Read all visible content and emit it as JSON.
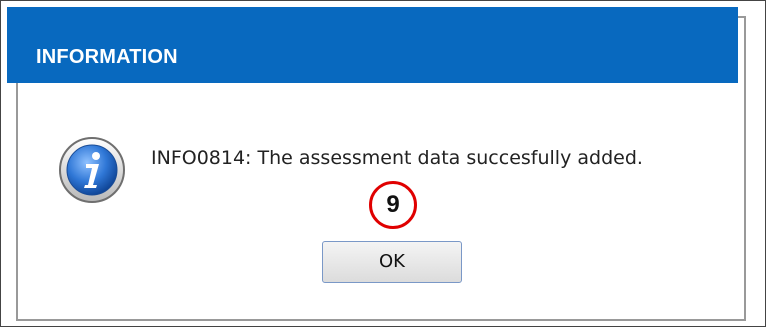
{
  "dialog": {
    "title": "INFORMATION",
    "message": "INFO0814: The assessment data succesfully added.",
    "icon": "info-icon",
    "ok_label": "OK"
  },
  "annotation": {
    "step_number": "9",
    "color": "#e00000"
  },
  "colors": {
    "titlebar": "#0869bf",
    "dialog_border": "#999999"
  }
}
